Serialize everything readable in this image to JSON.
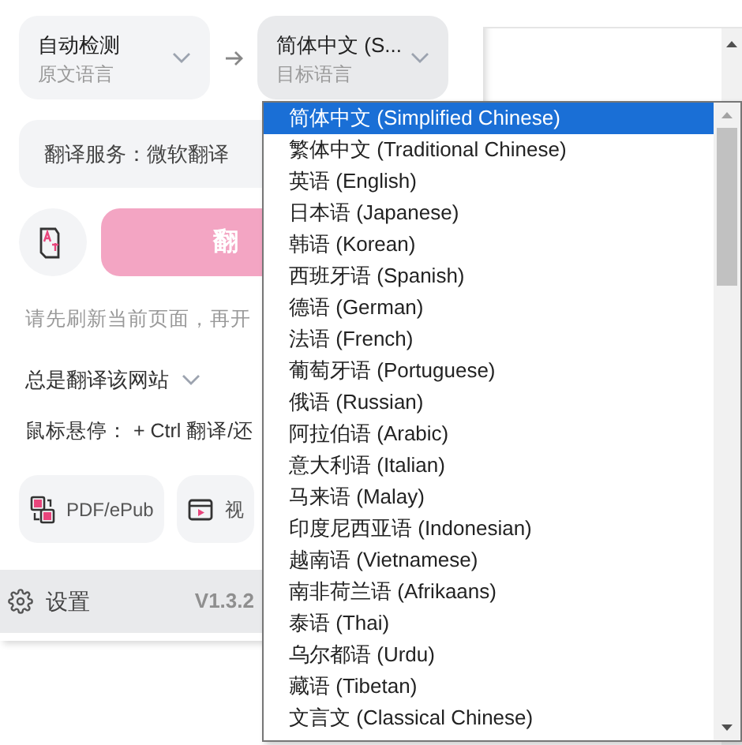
{
  "source_language": {
    "value": "自动检测",
    "label": "原文语言"
  },
  "target_language": {
    "value": "简体中文 (S...",
    "label": "目标语言"
  },
  "service": "翻译服务：微软翻译",
  "translate_button": "翻",
  "hint": "请先刷新当前页面，再开",
  "always_translate": "总是翻译该网站",
  "hover": "鼠标悬停： + Ctrl 翻译/还",
  "tools": [
    {
      "label": "PDF/ePub",
      "kind": "pdf"
    },
    {
      "label": "视",
      "kind": "video"
    }
  ],
  "footer": {
    "settings": "设置",
    "version": "V1.3.2"
  },
  "dropdown": {
    "options": [
      {
        "label": "简体中文 (Simplified Chinese)",
        "selected": true
      },
      {
        "label": "繁体中文 (Traditional Chinese)",
        "selected": false
      },
      {
        "label": "英语 (English)",
        "selected": false
      },
      {
        "label": "日本语 (Japanese)",
        "selected": false
      },
      {
        "label": "韩语 (Korean)",
        "selected": false
      },
      {
        "label": "西班牙语 (Spanish)",
        "selected": false
      },
      {
        "label": "德语 (German)",
        "selected": false
      },
      {
        "label": "法语 (French)",
        "selected": false
      },
      {
        "label": "葡萄牙语 (Portuguese)",
        "selected": false
      },
      {
        "label": "俄语 (Russian)",
        "selected": false
      },
      {
        "label": "阿拉伯语 (Arabic)",
        "selected": false
      },
      {
        "label": "意大利语 (Italian)",
        "selected": false
      },
      {
        "label": "马来语 (Malay)",
        "selected": false
      },
      {
        "label": "印度尼西亚语 (Indonesian)",
        "selected": false
      },
      {
        "label": "越南语 (Vietnamese)",
        "selected": false
      },
      {
        "label": "南非荷兰语 (Afrikaans)",
        "selected": false
      },
      {
        "label": "泰语 (Thai)",
        "selected": false
      },
      {
        "label": "乌尔都语 (Urdu)",
        "selected": false
      },
      {
        "label": "藏语 (Tibetan)",
        "selected": false
      },
      {
        "label": "文言文 (Classical Chinese)",
        "selected": false
      }
    ]
  }
}
